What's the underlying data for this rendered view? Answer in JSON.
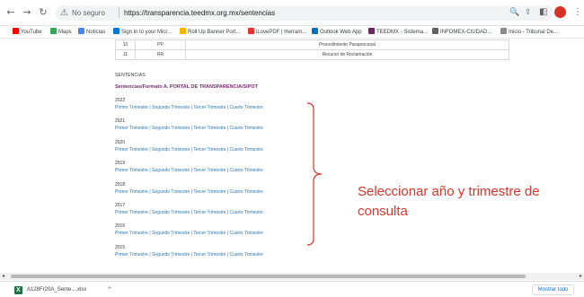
{
  "browser": {
    "back_glyph": "←",
    "forward_glyph": "→",
    "reload_glyph": "↻",
    "security_icon": "⚠",
    "security_label": "No seguro",
    "url": "https://transparencia.teedmx.org.mx/sentencias",
    "zoom_icon": "🔍",
    "share_icon": "⇪",
    "star_icon": "☆",
    "sidepanel_icon": "◧",
    "avatar_initial": "",
    "menu_icon": "⋮"
  },
  "bookmarks": [
    {
      "label": "YouTube",
      "icon": "youtube-icon",
      "color": "#ff0000"
    },
    {
      "label": "Maps",
      "icon": "maps-icon",
      "color": "#34a853"
    },
    {
      "label": "Noticias",
      "icon": "news-icon",
      "color": "#4285f4"
    },
    {
      "label": "Sign in to your Micr...",
      "icon": "microsoft-icon",
      "color": "#0078d4"
    },
    {
      "label": "Roll Up Banner Port...",
      "icon": "banner-icon",
      "color": "#f4b400"
    },
    {
      "label": "iLovePDF | Herram...",
      "icon": "ilovepdf-icon",
      "color": "#e5322d"
    },
    {
      "label": "Outlook Web App",
      "icon": "outlook-icon",
      "color": "#0072c6"
    },
    {
      "label": "TEEDMX - Sistema...",
      "icon": "teedmx-icon",
      "color": "#6b2a5f"
    },
    {
      "label": "INFOMEX-CIUDAD...",
      "icon": "globe-icon",
      "color": "#5f6368"
    },
    {
      "label": "Inicio - Tribunal De...",
      "icon": "court-icon",
      "color": "#8a8a8a"
    }
  ],
  "prev_table": {
    "rows": [
      {
        "id": "10",
        "code": "PP",
        "label": "Procedimiento Paraprocesal"
      },
      {
        "id": "11",
        "code": "RR",
        "label": "Recurso de Reclamación"
      }
    ]
  },
  "sentencias": {
    "heading": "SENTENCIAS",
    "subheading": "Sentencias/Formato A. PORTAL DE TRANSPARENCIA/SIPOT",
    "quarters": [
      "Primer Trimestre",
      "Segundo Trimestre",
      "Tercer Trimestre",
      "Cuarto Trimestre"
    ],
    "separator": "|",
    "years": [
      "2022",
      "2021",
      "2020",
      "2019",
      "2018",
      "2017",
      "2016",
      "2015"
    ]
  },
  "annotation": {
    "text": "Seleccionar año y trimestre de consulta",
    "color": "#d9352c"
  },
  "scrollbar": {
    "left_arrow": "◂",
    "right_arrow": "▸"
  },
  "download_shelf": {
    "file_name": "A128Fr20A_Sente....xlsx",
    "file_icon_letter": "X",
    "chevron": "^",
    "show_all": "Mostrar todo"
  }
}
